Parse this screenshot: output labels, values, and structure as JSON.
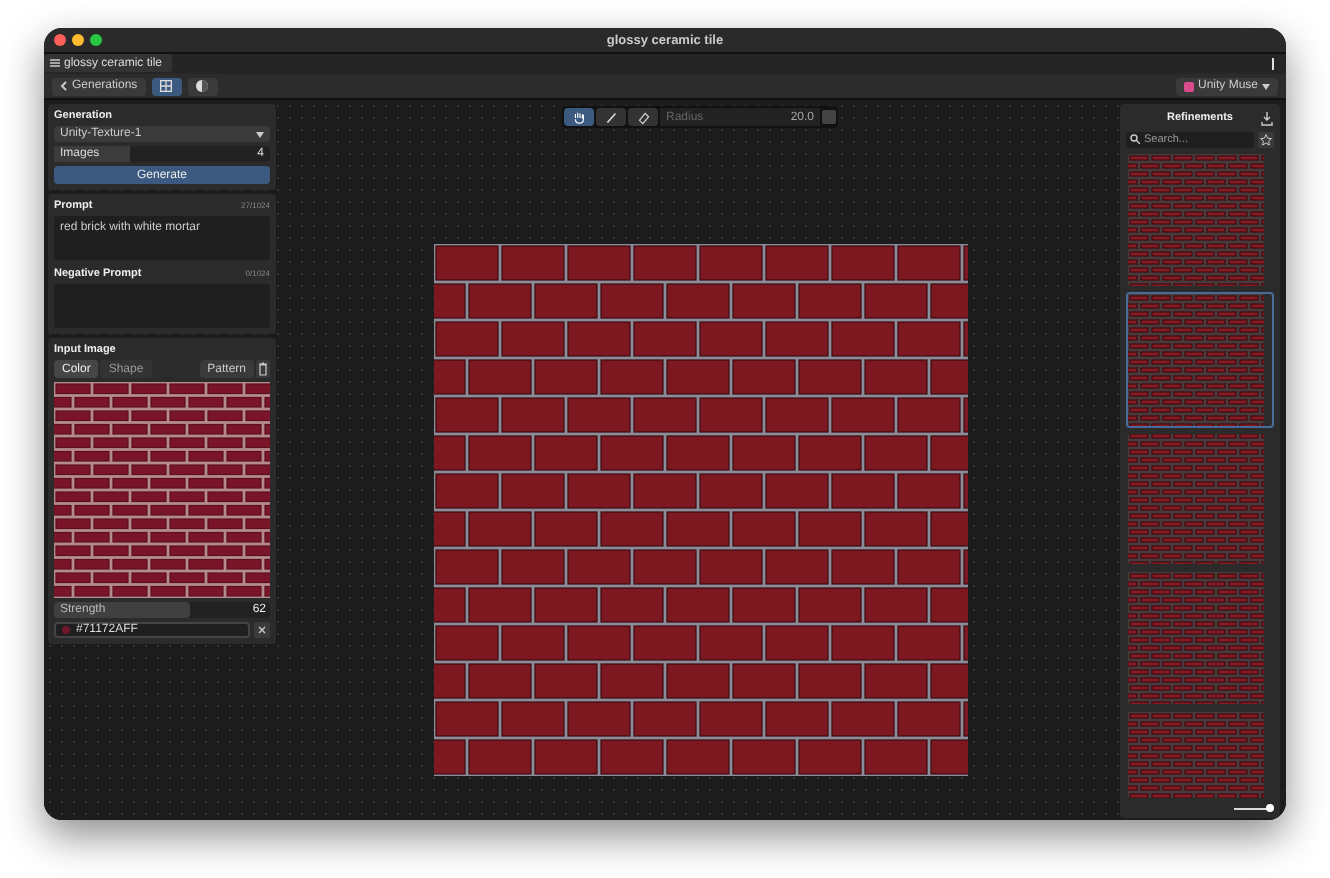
{
  "window": {
    "title": "glossy ceramic tile"
  },
  "document_tab": {
    "label": "glossy ceramic tile"
  },
  "toolbar": {
    "back_button": "Generations",
    "view_buttons": [
      {
        "kind": "grid",
        "selected": true
      },
      {
        "kind": "sphere",
        "selected": false
      }
    ],
    "account": "Unity Muse"
  },
  "generation": {
    "title": "Generation",
    "model": "Unity-Texture-1",
    "images_label": "Images",
    "images_value": "4",
    "generate_button": "Generate"
  },
  "prompt": {
    "title": "Prompt",
    "counter": "27/1024",
    "value": "red brick with white mortar"
  },
  "negative_prompt": {
    "title": "Negative Prompt",
    "counter": "0/1024"
  },
  "input_image": {
    "title": "Input Image",
    "modes": [
      {
        "label": "Color",
        "selected": true
      },
      {
        "label": "Shape",
        "selected": false
      }
    ],
    "pattern_button": "Pattern",
    "strength_label": "Strength",
    "strength": {
      "level": 0.63
    },
    "strength_value": "62",
    "color_value": "#71172AFF",
    "color": "#71172a"
  },
  "canvas_tools": {
    "tools": [
      {
        "kind": "hand",
        "selected": true
      },
      {
        "kind": "brush",
        "selected": false
      },
      {
        "kind": "eraser",
        "selected": false
      }
    ],
    "radius_label": "Radius",
    "radius_value": "20.0"
  },
  "refinements": {
    "title": "Refinements",
    "search_placeholder": "Search...",
    "thumbnails": [
      {
        "selected": false
      },
      {
        "selected": true
      },
      {
        "selected": false
      },
      {
        "selected": false
      },
      {
        "selected": false
      }
    ],
    "zoom_slider": {
      "level": 0.9
    }
  }
}
